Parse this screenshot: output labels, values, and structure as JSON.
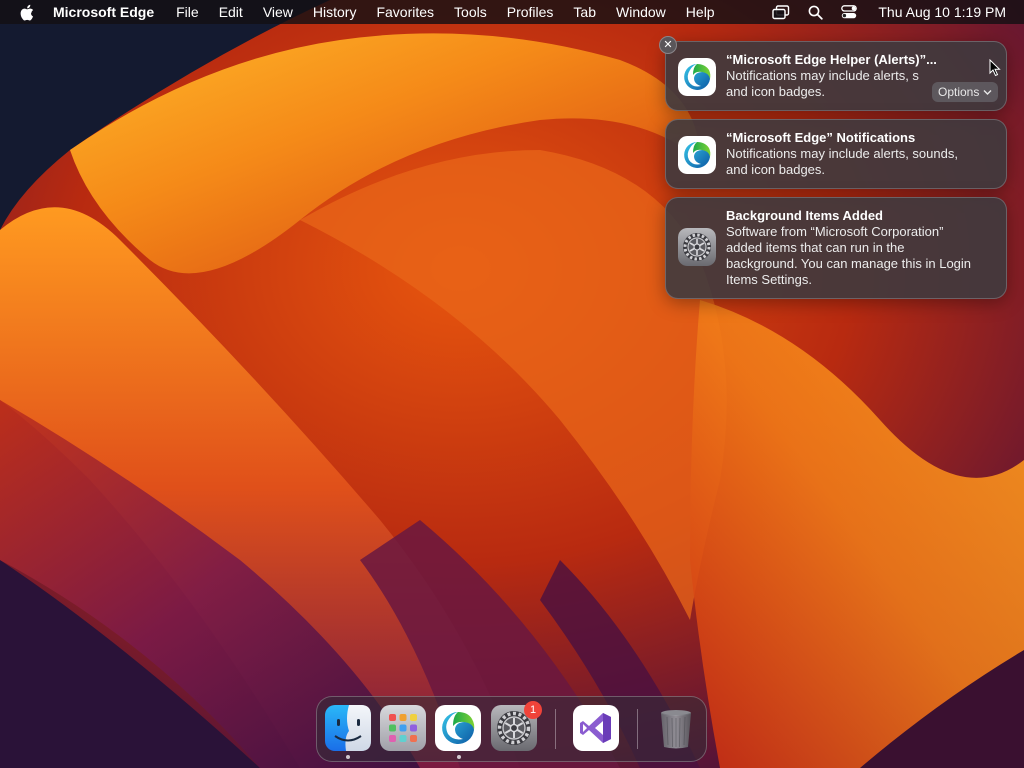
{
  "menubar": {
    "app_name": "Microsoft Edge",
    "menus": [
      "File",
      "Edit",
      "View",
      "History",
      "Favorites",
      "Tools",
      "Profiles",
      "Tab",
      "Window",
      "Help"
    ],
    "clock": "Thu Aug 10  1:19 PM"
  },
  "notifications": [
    {
      "title": "“Microsoft Edge Helper (Alerts)”...",
      "body": "Notifications may include alerts, s... and icon badges.",
      "body_lines": [
        "Notifications may include alerts, s",
        "and icon badges."
      ],
      "icon": "edge-icon",
      "options_label": "Options"
    },
    {
      "title": "“Microsoft Edge” Notifications",
      "body_lines": [
        "Notifications may include alerts, sounds,",
        "and icon badges."
      ],
      "icon": "edge-icon"
    },
    {
      "title": "Background Items Added",
      "body_lines": [
        "Software from “Microsoft Corporation”",
        "added items that can run in the",
        "background. You can manage this in Login",
        "Items Settings."
      ],
      "icon": "system-settings-icon"
    }
  ],
  "close_button_label": "✕",
  "dock": {
    "items": [
      "finder-icon",
      "launchpad-icon",
      "edge-icon",
      "system-settings-icon",
      "visual-studio-icon",
      "trash-icon"
    ],
    "settings_badge": "1"
  },
  "colors": {
    "wallpaper_orange": "#f5a020",
    "wallpaper_red": "#c82a10",
    "wallpaper_purple": "#5a1a50",
    "badge_red": "#f0433a"
  }
}
